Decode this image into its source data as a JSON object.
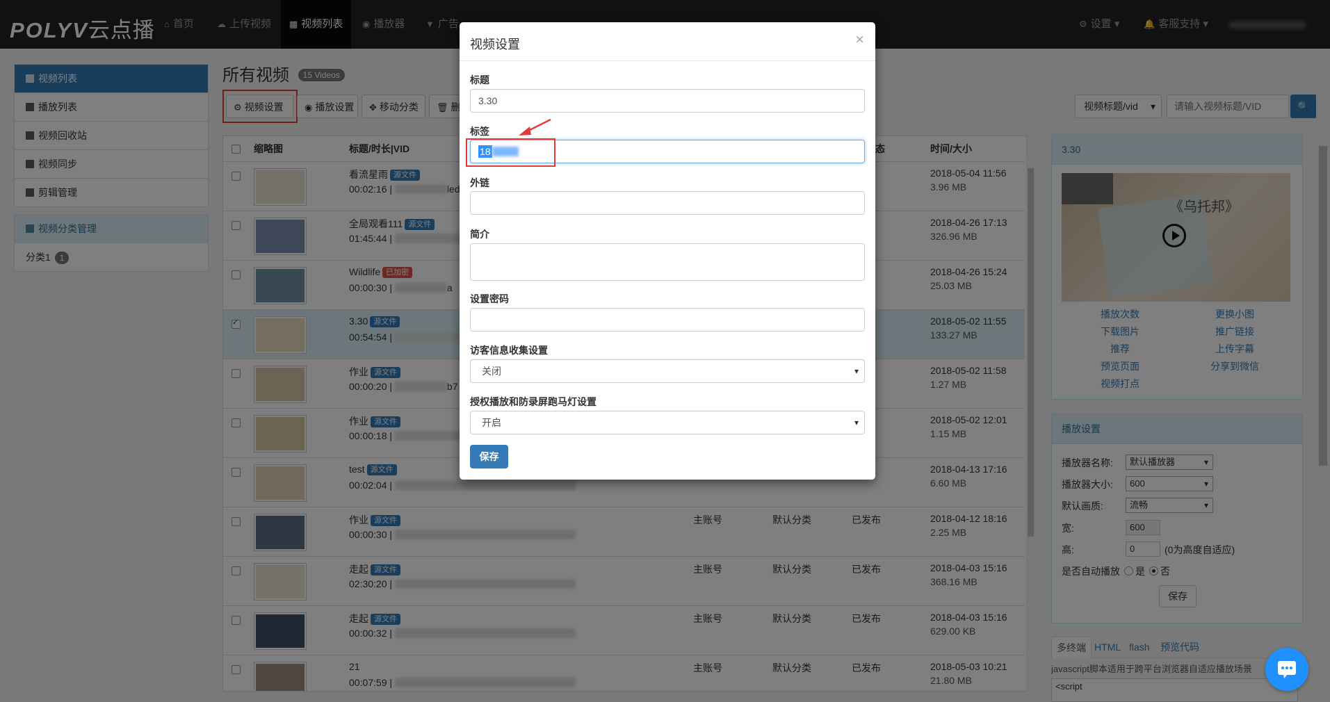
{
  "nav": {
    "logo_brand": "POLYV",
    "logo_cn": "云点播",
    "items": [
      {
        "label": "首页",
        "icon": "home-icon"
      },
      {
        "label": "上传视频",
        "icon": "upload-icon"
      },
      {
        "label": "视频列表",
        "icon": "film-icon",
        "active": true
      },
      {
        "label": "播放器",
        "icon": "play-circle-icon"
      },
      {
        "label": "广告",
        "icon": "filter-icon"
      }
    ],
    "settings_label": "设置",
    "support_label": "客服支持"
  },
  "sidebar": {
    "group1": [
      {
        "label": "视频列表",
        "active": true
      },
      {
        "label": "播放列表"
      },
      {
        "label": "视频回收站"
      },
      {
        "label": "视频同步"
      },
      {
        "label": "剪辑管理"
      }
    ],
    "group2_header": "视频分类管理",
    "categories": [
      {
        "label": "分类1",
        "count": "1"
      }
    ]
  },
  "main": {
    "title": "所有视频",
    "count_badge": "15 Videos",
    "toolbar": {
      "video_settings": "视频设置",
      "play_settings": "播放设置",
      "move_category": "移动分类",
      "delete_partial": "删"
    },
    "search": {
      "select_value": "视频标题/vid",
      "placeholder": "请输入视频标题/VID"
    },
    "columns": {
      "thumb": "缩略图",
      "title": "标题/时长|VID",
      "status_partial": "态",
      "time_size": "时间/大小"
    },
    "rows": [
      {
        "title": "看流星雨",
        "tag": "源文件",
        "duration": "00:02:16",
        "vid_tail": "led",
        "owner": "",
        "category": "",
        "status": "",
        "date": "2018-05-04 11:56",
        "size": "3.96 MB"
      },
      {
        "title": "全局观看111",
        "tag": "源文件",
        "duration": "01:45:44",
        "vid_tail": "",
        "owner": "",
        "category": "",
        "status": "",
        "date": "2018-04-26 17:13",
        "size": "326.96 MB"
      },
      {
        "title": "Wildlife",
        "tag": "已加密",
        "tag_red": true,
        "duration": "00:00:30",
        "vid_tail": "a",
        "owner": "",
        "category": "",
        "status": "",
        "date": "2018-04-26 15:24",
        "size": "25.03 MB"
      },
      {
        "title": "3.30",
        "tag": "源文件",
        "duration": "00:54:54",
        "vid_tail": "",
        "owner": "",
        "category": "",
        "status": "",
        "date": "2018-05-02 11:55",
        "size": "133.27 MB",
        "selected": true
      },
      {
        "title": "作业",
        "tag": "源文件",
        "duration": "00:00:20",
        "vid_tail": "b7",
        "owner": "",
        "category": "",
        "status": "",
        "date": "2018-05-02 11:58",
        "size": "1.27 MB"
      },
      {
        "title": "作业",
        "tag": "源文件",
        "duration": "00:00:18",
        "vid_tail": "",
        "owner": "",
        "category": "",
        "status": "",
        "date": "2018-05-02 12:01",
        "size": "1.15 MB"
      },
      {
        "title": "test",
        "tag": "源文件",
        "duration": "00:02:04",
        "vid_tail": "",
        "owner": "",
        "category": "",
        "status": "",
        "date": "2018-04-13 17:16",
        "size": "6.60 MB"
      },
      {
        "title": "作业",
        "tag": "源文件",
        "duration": "00:00:30",
        "vid_tail": "",
        "owner": "主账号",
        "category": "默认分类",
        "status": "已发布",
        "date": "2018-04-12 18:16",
        "size": "2.25 MB"
      },
      {
        "title": "走起",
        "tag": "源文件",
        "duration": "02:30:20",
        "vid_tail": "",
        "owner": "主账号",
        "category": "默认分类",
        "status": "已发布",
        "date": "2018-04-03 15:16",
        "size": "368.16 MB"
      },
      {
        "title": "走起",
        "tag": "源文件",
        "duration": "00:00:32",
        "vid_tail": "",
        "owner": "主账号",
        "category": "默认分类",
        "status": "已发布",
        "date": "2018-04-03 15:16",
        "size": "629.00 KB"
      },
      {
        "title": "21",
        "tag": "",
        "duration": "00:07:59",
        "vid_tail": "",
        "owner": "主账号",
        "category": "默认分类",
        "status": "已发布",
        "date": "2018-05-03 10:21",
        "size": "21.80 MB"
      }
    ]
  },
  "preview_panel": {
    "title": "3.30",
    "thumb_caption": "《乌托邦》",
    "links_left": [
      "播放次数",
      "下载图片",
      "推荐",
      "预览页面",
      "视频打点"
    ],
    "links_right": [
      "更换小图",
      "推广链接",
      "上传字幕",
      "分享到微信"
    ]
  },
  "play_settings": {
    "header": "播放设置",
    "player_name_label": "播放器名称:",
    "player_name_value": "默认播放器",
    "player_size_label": "播放器大小:",
    "player_size_value": "600",
    "quality_label": "默认画质:",
    "quality_value": "流畅",
    "width_label": "宽:",
    "width_value": "600",
    "height_label": "高:",
    "height_value": "0",
    "height_hint": "(0为高度自适应)",
    "autoplay_label": "是否自动播放",
    "autoplay_yes": "是",
    "autoplay_no": "否",
    "save": "保存"
  },
  "code_tabs": {
    "tabs": [
      "多终端",
      "HTML",
      "flash",
      "预览代码"
    ],
    "desc": "javascript脚本适用于跨平台浏览器自适应播放场景",
    "code_line": "<script"
  },
  "modal": {
    "title": "视频设置",
    "fields": {
      "title_label": "标题",
      "title_value": "3.30",
      "tags_label": "标签",
      "tags_value": "18",
      "link_label": "外链",
      "link_value": "",
      "intro_label": "简介",
      "intro_value": "",
      "password_label": "设置密码",
      "password_value": "",
      "visitor_label": "访客信息收集设置",
      "visitor_value": "关闭",
      "auth_label": "授权播放和防录屏跑马灯设置",
      "auth_value": "开启"
    },
    "save": "保存"
  },
  "colors": {
    "primary": "#337ab7",
    "nav_bg": "#222222",
    "highlight_red": "#e03c3c",
    "info_bg": "#d9edf7",
    "selected_text": "#3390ff"
  }
}
